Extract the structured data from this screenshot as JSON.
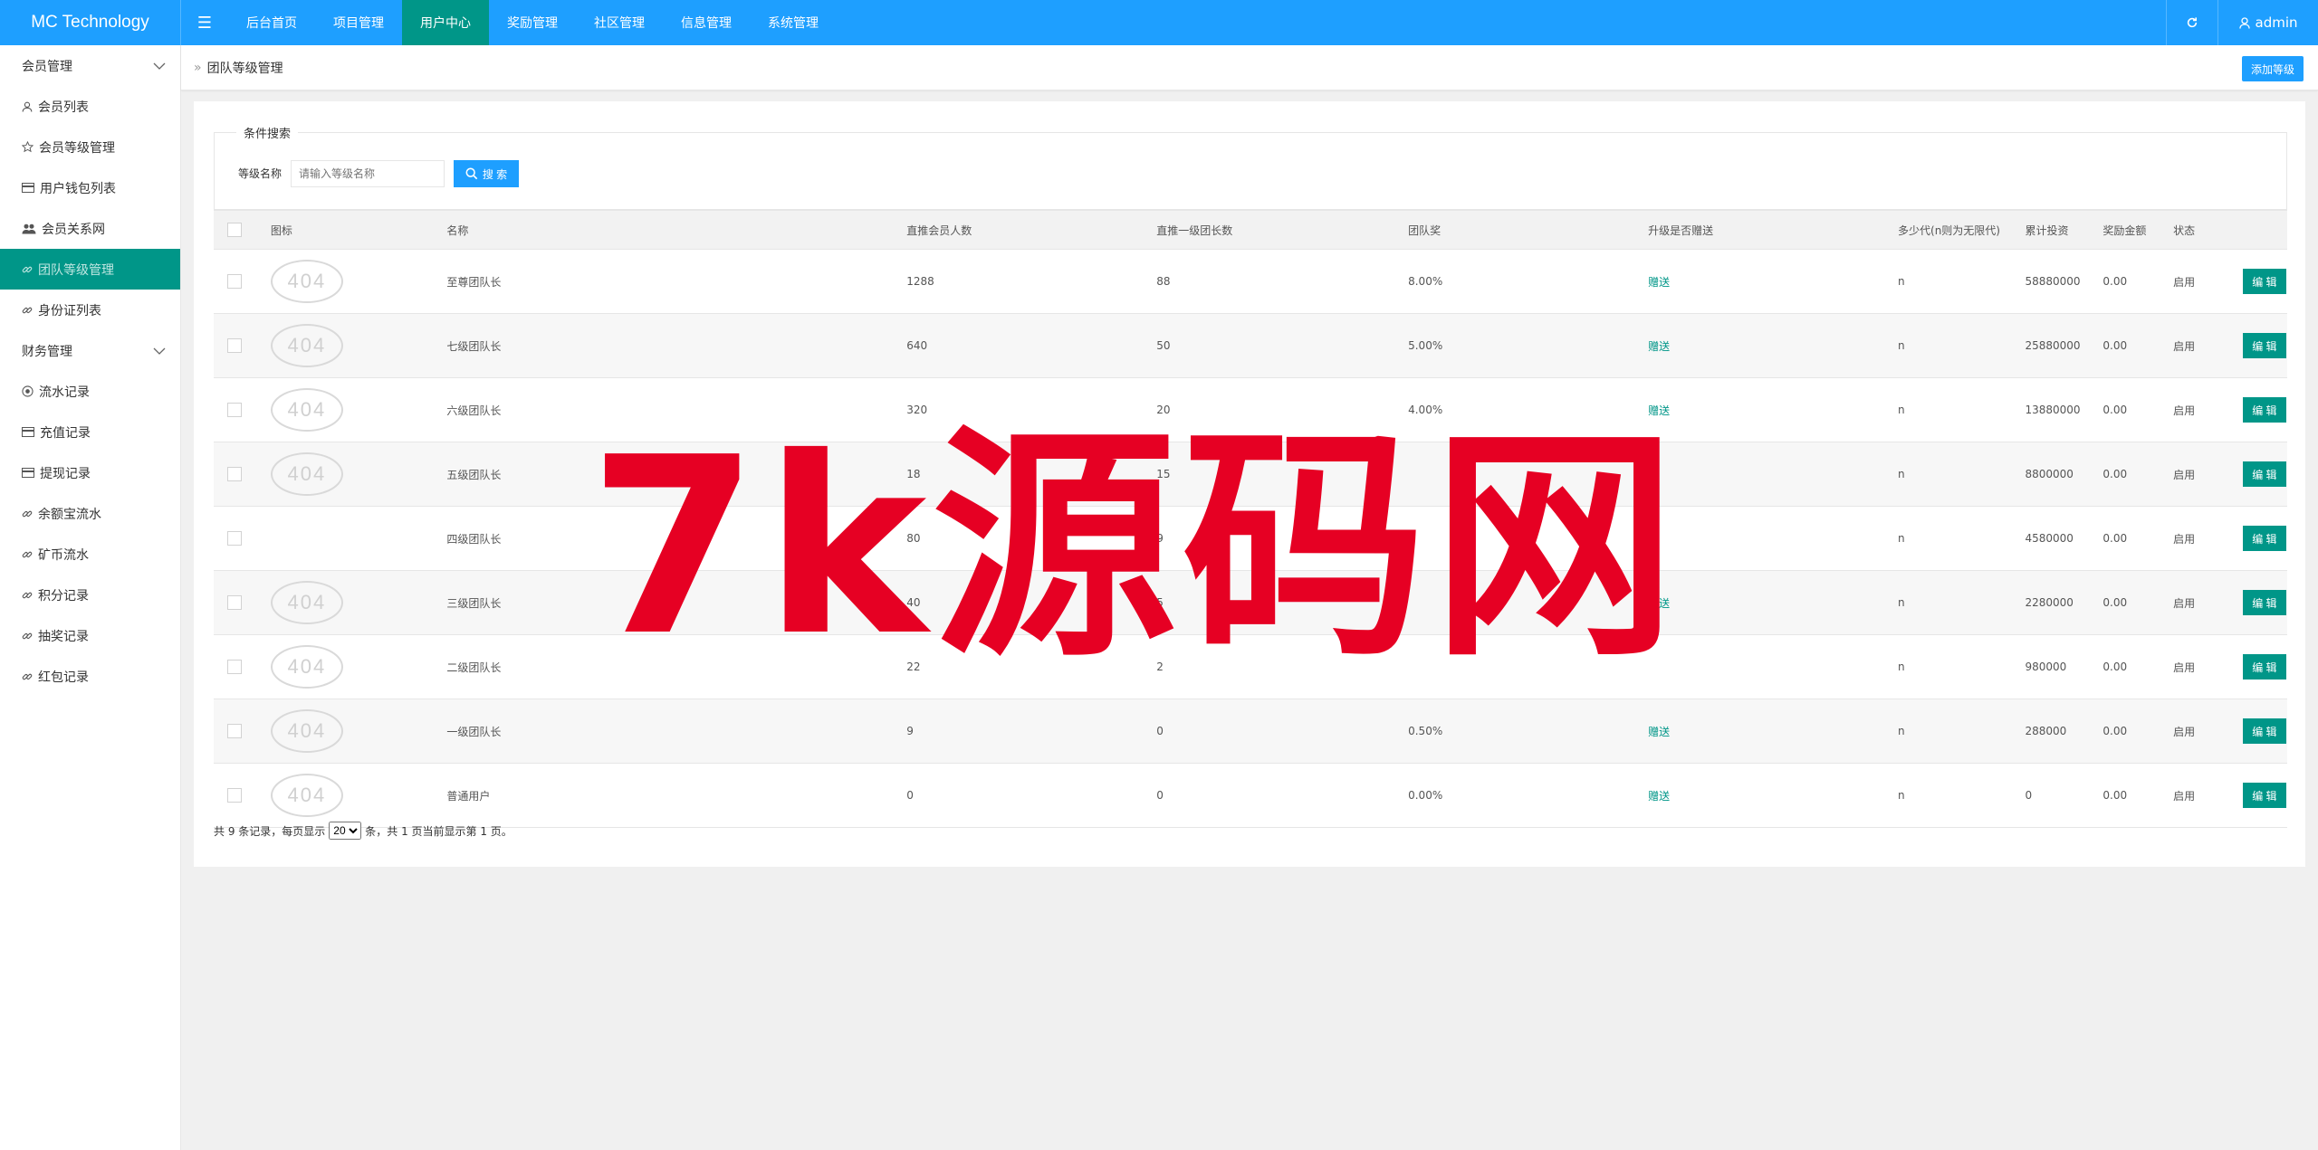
{
  "brand": "MC Technology",
  "nav": [
    {
      "label": "后台首页",
      "active": false
    },
    {
      "label": "项目管理",
      "active": false
    },
    {
      "label": "用户中心",
      "active": true
    },
    {
      "label": "奖励管理",
      "active": false
    },
    {
      "label": "社区管理",
      "active": false
    },
    {
      "label": "信息管理",
      "active": false
    },
    {
      "label": "系统管理",
      "active": false
    }
  ],
  "user": {
    "name": "admin"
  },
  "sidebar": {
    "groups": [
      {
        "label": "会员管理",
        "items": [
          {
            "label": "会员列表",
            "icon": "user-icon",
            "active": false
          },
          {
            "label": "会员等级管理",
            "icon": "star-icon",
            "active": false
          },
          {
            "label": "用户钱包列表",
            "icon": "card-icon",
            "active": false
          },
          {
            "label": "会员关系网",
            "icon": "users-icon",
            "active": false
          },
          {
            "label": "团队等级管理",
            "icon": "link-icon",
            "active": true
          },
          {
            "label": "身份证列表",
            "icon": "link-icon",
            "active": false
          }
        ]
      },
      {
        "label": "财务管理",
        "items": [
          {
            "label": "流水记录",
            "icon": "coin-icon",
            "active": false
          },
          {
            "label": "充值记录",
            "icon": "card-icon",
            "active": false
          },
          {
            "label": "提现记录",
            "icon": "card-icon",
            "active": false
          },
          {
            "label": "余额宝流水",
            "icon": "link-icon",
            "active": false
          },
          {
            "label": "矿币流水",
            "icon": "link-icon",
            "active": false
          },
          {
            "label": "积分记录",
            "icon": "link-icon",
            "active": false
          },
          {
            "label": "抽奖记录",
            "icon": "link-icon",
            "active": false
          },
          {
            "label": "红包记录",
            "icon": "link-icon",
            "active": false
          }
        ]
      }
    ]
  },
  "breadcrumb": {
    "sep": "»",
    "title": "团队等级管理"
  },
  "add_button": "添加等级",
  "search": {
    "legend": "条件搜索",
    "label": "等级名称",
    "placeholder": "请输入等级名称",
    "button": "搜 索"
  },
  "table": {
    "headers": [
      "图标",
      "名称",
      "直推会员人数",
      "直推一级团长数",
      "团队奖",
      "升级是否赠送",
      "多少代(n则为无限代)",
      "累计投资",
      "奖励金额",
      "状态"
    ],
    "icon_text": "404",
    "edit_label": "编 辑",
    "rows": [
      {
        "icon": true,
        "name": "至尊团队长",
        "members": "1288",
        "leaders": "88",
        "bonus": "8.00%",
        "gift": "赠送",
        "gen": "n",
        "invest": "58880000",
        "reward": "0.00",
        "status": "启用"
      },
      {
        "icon": true,
        "name": "七级团队长",
        "members": "640",
        "leaders": "50",
        "bonus": "5.00%",
        "gift": "赠送",
        "gen": "n",
        "invest": "25880000",
        "reward": "0.00",
        "status": "启用"
      },
      {
        "icon": true,
        "name": "六级团队长",
        "members": "320",
        "leaders": "20",
        "bonus": "4.00%",
        "gift": "赠送",
        "gen": "n",
        "invest": "13880000",
        "reward": "0.00",
        "status": "启用"
      },
      {
        "icon": true,
        "name": "五级团队长",
        "members": "18",
        "leaders": "15",
        "bonus": "",
        "gift": "",
        "gen": "n",
        "invest": "8800000",
        "reward": "0.00",
        "status": "启用"
      },
      {
        "icon": false,
        "name": "四级团队长",
        "members": "80",
        "leaders": "9",
        "bonus": "",
        "gift": "",
        "gen": "n",
        "invest": "4580000",
        "reward": "0.00",
        "status": "启用"
      },
      {
        "icon": true,
        "name": "三级团队长",
        "members": "40",
        "leaders": "5",
        "bonus": "",
        "gift": "赠送",
        "gen": "n",
        "invest": "2280000",
        "reward": "0.00",
        "status": "启用"
      },
      {
        "icon": true,
        "name": "二级团队长",
        "members": "22",
        "leaders": "2",
        "bonus": "",
        "gift": "",
        "gen": "n",
        "invest": "980000",
        "reward": "0.00",
        "status": "启用"
      },
      {
        "icon": true,
        "name": "一级团队长",
        "members": "9",
        "leaders": "0",
        "bonus": "0.50%",
        "gift": "赠送",
        "gen": "n",
        "invest": "288000",
        "reward": "0.00",
        "status": "启用"
      },
      {
        "icon": true,
        "name": "普通用户",
        "members": "0",
        "leaders": "0",
        "bonus": "0.00%",
        "gift": "赠送",
        "gen": "n",
        "invest": "0",
        "reward": "0.00",
        "status": "启用"
      }
    ]
  },
  "pager": {
    "before": "共 9 条记录，每页显示",
    "page_size": "20",
    "after": "条，共 1 页当前显示第 1 页。"
  },
  "watermark": "7k源码网",
  "colors": {
    "primary": "#1e9fff",
    "accent": "#009688",
    "watermark": "#e60023"
  }
}
